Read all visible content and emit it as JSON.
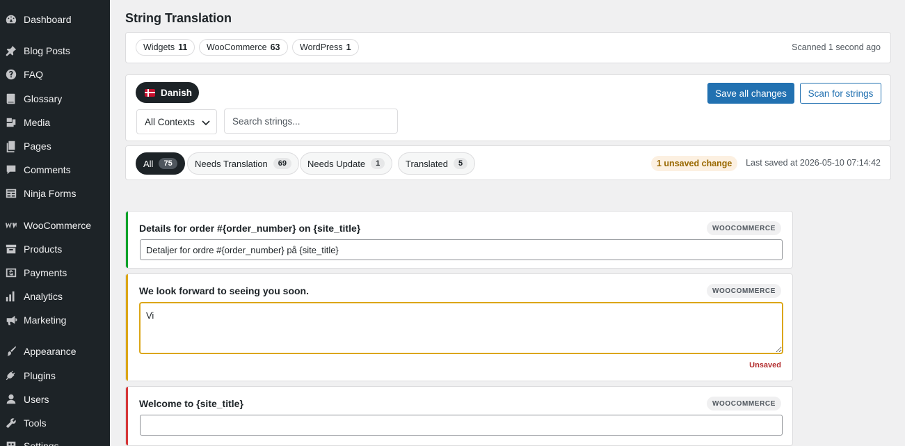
{
  "sidebar": {
    "items": [
      {
        "label": "Dashboard",
        "icon": "dashboard-icon"
      },
      {
        "label": "Blog Posts",
        "icon": "pin-icon"
      },
      {
        "label": "FAQ",
        "icon": "help-icon"
      },
      {
        "label": "Glossary",
        "icon": "book-icon"
      },
      {
        "label": "Media",
        "icon": "media-icon"
      },
      {
        "label": "Pages",
        "icon": "pages-icon"
      },
      {
        "label": "Comments",
        "icon": "comment-icon"
      },
      {
        "label": "Ninja Forms",
        "icon": "forms-icon"
      },
      {
        "label": "WooCommerce",
        "icon": "woocommerce-icon"
      },
      {
        "label": "Products",
        "icon": "archive-icon"
      },
      {
        "label": "Payments",
        "icon": "dollar-icon"
      },
      {
        "label": "Analytics",
        "icon": "bar-chart-icon"
      },
      {
        "label": "Marketing",
        "icon": "megaphone-icon"
      },
      {
        "label": "Appearance",
        "icon": "brush-icon"
      },
      {
        "label": "Plugins",
        "icon": "plug-icon"
      },
      {
        "label": "Users",
        "icon": "user-icon"
      },
      {
        "label": "Tools",
        "icon": "wrench-icon"
      },
      {
        "label": "Settings",
        "icon": "settings-icon"
      }
    ]
  },
  "page": {
    "title": "String Translation"
  },
  "domains": {
    "chips": [
      {
        "name": "Widgets",
        "count": "11"
      },
      {
        "name": "WooCommerce",
        "count": "63"
      },
      {
        "name": "WordPress",
        "count": "1"
      }
    ],
    "scanned": "Scanned 1 second ago"
  },
  "controls": {
    "language": "Danish",
    "save_label": "Save all changes",
    "scan_label": "Scan for strings",
    "context_select": "All Contexts",
    "search_placeholder": "Search strings..."
  },
  "filters": {
    "tabs": [
      {
        "label": "All",
        "count": "75",
        "active": true
      },
      {
        "label": "Needs Translation",
        "count": "69",
        "active": false
      },
      {
        "label": "Needs Update",
        "count": "1",
        "active": false
      },
      {
        "label": "Translated",
        "count": "5",
        "active": false
      }
    ],
    "unsaved_badge": "1 unsaved change",
    "last_saved": "Last saved at 2026-05-10 07:14:42"
  },
  "strings": [
    {
      "source": "Details for order #{order_number} on {site_title}",
      "domain": "WOOCOMMERCE",
      "translation": "Detaljer for ordre #{order_number} på {site_title}",
      "status": "translated",
      "status_color": "#00a32a"
    },
    {
      "source": "We look forward to seeing you soon.",
      "domain": "WOOCOMMERCE",
      "translation": "Vi",
      "status": "unsaved",
      "status_color": "#dba617",
      "unsaved_label": "Unsaved"
    },
    {
      "source": "Welcome to {site_title}",
      "domain": "WOOCOMMERCE",
      "translation": "",
      "status": "needs-translation",
      "status_color": "#d63638"
    }
  ]
}
